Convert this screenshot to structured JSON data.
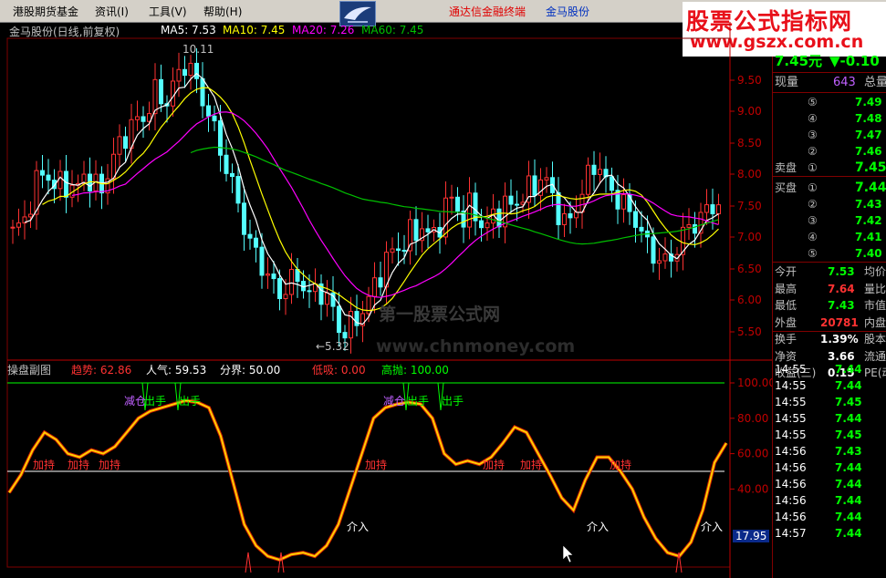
{
  "menu": {
    "items": [
      "港股期货基金",
      "资讯(I)",
      "工具(V)",
      "帮助(H)"
    ],
    "center_left": "通达信金融终端",
    "center_right": "金马股份"
  },
  "brand": {
    "line1": "股票公式指标网",
    "line2": "www.gszx.com.cn"
  },
  "colors": {
    "bg": "#000000",
    "up": "#ff3232",
    "down": "#54ffff",
    "ma5": "#ffffff",
    "ma10": "#ffff00",
    "ma20": "#ff00ff",
    "ma60": "#00c000",
    "grid": "#800000",
    "axis": "#c00000",
    "green": "#00ff00",
    "purple": "#c060ff"
  },
  "main_chart": {
    "title": "金马股份(日线,前复权)",
    "ma5": "MA5: 7.53",
    "ma10": "MA10: 7.45",
    "ma20": "MA20: 7.26",
    "ma60": "MA60: 7.45",
    "high_label": "10.11",
    "low_label": "←5.32",
    "watermark1": "第一股票公式网",
    "watermark2": "www.chnmoney.com"
  },
  "sub_chart": {
    "name": "操盘副图",
    "trend": "趋势: 62.86",
    "popularity": "人气: 59.53",
    "boundary": "分界: 50.00",
    "low_absorb": "低吸: 0.00",
    "high_throw": "高抛: 100.00",
    "current_value": "17.95",
    "signals": {
      "hold": "加持",
      "entry": "介入",
      "reduce": "减仓",
      "exit": "出手"
    }
  },
  "chart_data": [
    {
      "type": "candlestick",
      "title": "金马股份(日线,前复权)",
      "y_ticks": [
        "9.50",
        "9.00",
        "8.50",
        "8.00",
        "7.50",
        "7.00",
        "6.50",
        "6.00",
        "5.50"
      ],
      "ylim": [
        5.2,
        10.2
      ],
      "high": 10.11,
      "low": 5.32,
      "close_path": [
        7.2,
        7.4,
        7.8,
        8.3,
        7.9,
        8.1,
        7.8,
        8.2,
        7.9,
        8.0,
        8.5,
        8.8,
        9.0,
        9.1,
        9.5,
        9.3,
        9.7,
        10.0,
        9.6,
        9.2,
        8.7,
        8.2,
        7.7,
        7.1,
        6.8,
        6.5,
        6.2,
        6.4,
        6.5,
        6.2,
        6.3,
        6.1,
        5.6,
        5.7,
        5.9,
        6.2,
        6.6,
        6.9,
        7.0,
        7.2,
        7.3,
        7.1,
        7.5,
        7.8,
        7.4,
        7.7,
        7.2,
        7.5,
        7.6,
        7.7,
        7.8,
        8.0,
        8.1,
        7.7,
        7.3,
        7.6,
        8.0,
        8.4,
        8.0,
        7.8,
        7.6,
        7.4,
        7.0,
        6.8,
        6.7,
        7.0,
        7.3,
        7.4,
        7.6,
        7.7
      ],
      "series": [
        {
          "name": "MA5",
          "value": 7.53
        },
        {
          "name": "MA10",
          "value": 7.45
        },
        {
          "name": "MA20",
          "value": 7.26
        },
        {
          "name": "MA60",
          "value": 7.45
        }
      ]
    },
    {
      "type": "line",
      "title": "操盘副图",
      "y_ticks": [
        "100.00",
        "80.00",
        "60.00",
        "40.00"
      ],
      "ylim": [
        0,
        100
      ],
      "reference_lines": [
        100,
        50
      ],
      "trend": [
        38,
        48,
        62,
        72,
        68,
        60,
        58,
        62,
        60,
        64,
        72,
        80,
        84,
        86,
        88,
        90,
        89,
        86,
        70,
        45,
        20,
        8,
        2,
        0,
        3,
        4,
        2,
        8,
        20,
        40,
        60,
        80,
        86,
        88,
        89,
        88,
        80,
        60,
        54,
        56,
        54,
        58,
        66,
        75,
        72,
        60,
        48,
        35,
        28,
        45,
        58,
        58,
        50,
        40,
        24,
        12,
        4,
        2,
        10,
        28,
        55,
        66
      ]
    }
  ],
  "panel": {
    "price": "7.45元",
    "change": "▼-0.10",
    "current_vol_label": "现量",
    "current_vol": "643",
    "total_label": "总量",
    "sell_label": "卖盘",
    "sells": [
      {
        "n": "⑤",
        "p": "7.49"
      },
      {
        "n": "④",
        "p": "7.48"
      },
      {
        "n": "③",
        "p": "7.47"
      },
      {
        "n": "②",
        "p": "7.46"
      },
      {
        "n": "①",
        "p": "7.45"
      }
    ],
    "buy_label": "买盘",
    "buys": [
      {
        "n": "①",
        "p": "7.44"
      },
      {
        "n": "②",
        "p": "7.43"
      },
      {
        "n": "③",
        "p": "7.42"
      },
      {
        "n": "④",
        "p": "7.41"
      },
      {
        "n": "⑤",
        "p": "7.40"
      }
    ],
    "stats": [
      {
        "k": "今开",
        "v": "7.53",
        "r": "均价"
      },
      {
        "k": "最高",
        "v": "7.64",
        "r": "量比"
      },
      {
        "k": "最低",
        "v": "7.43",
        "r": "市值"
      },
      {
        "k": "外盘",
        "v": "20781",
        "r": "内盘"
      },
      {
        "k": "换手",
        "v": "1.39%",
        "r": "股本"
      },
      {
        "k": "净资",
        "v": "3.66",
        "r": "流通"
      },
      {
        "k": "收益(三)",
        "v": "0.15",
        "r": "PE(动)"
      }
    ],
    "ticks": [
      {
        "t": "14:55",
        "p": "7.44"
      },
      {
        "t": "14:55",
        "p": "7.44"
      },
      {
        "t": "14:55",
        "p": "7.45"
      },
      {
        "t": "14:55",
        "p": "7.44"
      },
      {
        "t": "14:55",
        "p": "7.45"
      },
      {
        "t": "14:56",
        "p": "7.43"
      },
      {
        "t": "14:56",
        "p": "7.44"
      },
      {
        "t": "14:56",
        "p": "7.44"
      },
      {
        "t": "14:56",
        "p": "7.44"
      },
      {
        "t": "14:56",
        "p": "7.44"
      },
      {
        "t": "14:57",
        "p": "7.44"
      }
    ]
  }
}
